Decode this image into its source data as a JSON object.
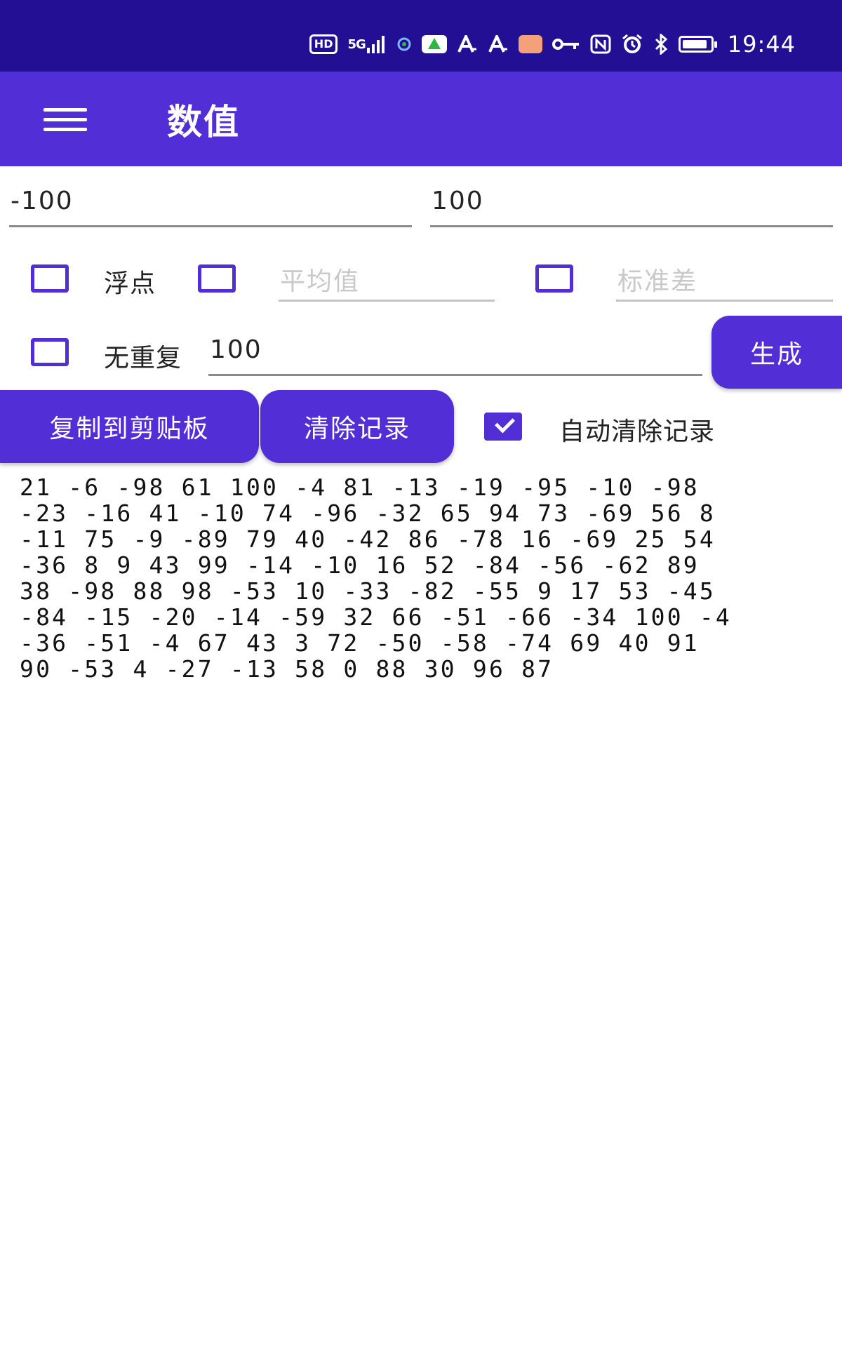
{
  "status_bar": {
    "time": "19:44",
    "hd_label": "HD",
    "signal_label": "5G",
    "icons": [
      "hd-icon",
      "signal-icon",
      "wifi-icon",
      "app-icon-green",
      "font-icon",
      "font-icon",
      "message-icon",
      "key-icon",
      "nfc-icon",
      "alarm-icon",
      "bluetooth-icon",
      "battery-icon"
    ]
  },
  "app_bar": {
    "title": "数值",
    "menu_icon": "menu-icon"
  },
  "form": {
    "min_value": "-100",
    "max_value": "100",
    "float_label": "浮点",
    "float_checked": false,
    "mean_checked": false,
    "mean_placeholder": "平均值",
    "stddev_checked": false,
    "stddev_placeholder": "标准差",
    "no_repeat_checked": false,
    "no_repeat_label": "无重复",
    "count_value": "100",
    "generate_label": "生成"
  },
  "actions": {
    "copy_label": "复制到剪贴板",
    "clear_label": "清除记录",
    "auto_clear_checked": true,
    "auto_clear_label": "自动清除记录"
  },
  "output": {
    "lines": [
      "21 -6 -98 61 100 -4 81 -13 -19 -95 -10 -98",
      "-23 -16 41 -10 74 -96 -32 65 94 73 -69 56 8",
      "-11 75 -9 -89 79 40 -42 86 -78 16 -69 25 54",
      "-36 8 9 43 99 -14 -10 16 52 -84 -56 -62 89",
      "38 -98 88 98 -53 10 -33 -82 -55 9 17 53 -45",
      "-84 -15 -20 -14 -59 32 66 -51 -66 -34 100 -4",
      "-36 -51 -4 67 43 3 72 -50 -58 -74 69 40 91",
      "90 -53 4 -27 -13 58 0 88 30 96 87"
    ]
  },
  "colors": {
    "status_bar": "#230f93",
    "primary": "#512ed6",
    "background": "#ffffff"
  }
}
